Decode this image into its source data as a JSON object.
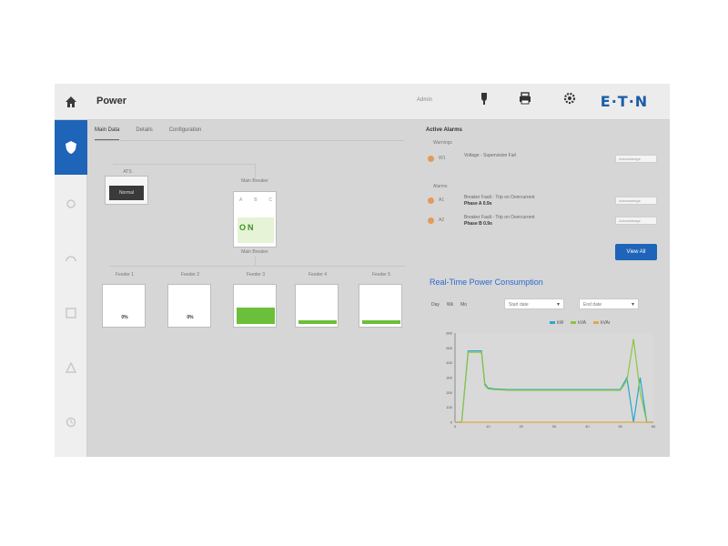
{
  "header": {
    "title": "Power",
    "user_text": "Admin",
    "icons": [
      {
        "name": "plug-icon",
        "label": ""
      },
      {
        "name": "print-icon",
        "label": ""
      },
      {
        "name": "gear-icon",
        "label": ""
      }
    ],
    "logo_text": "E·T·N"
  },
  "rail": {
    "active_icon": "shield-icon",
    "items": [
      "settings-icon",
      "meter-icon",
      "grid-icon",
      "alarm-icon",
      "history-icon"
    ]
  },
  "tabs": [
    "Main Data",
    "Details",
    "Configuration"
  ],
  "oneline": {
    "source_label": "ATS",
    "source_value": "Normal",
    "breaker_title": "Main Breaker",
    "breaker_labels": [
      "A",
      "B",
      "C"
    ],
    "breaker_value": "ON",
    "breaker_sub": "Main Breaker",
    "meters": [
      {
        "label": "Feeder 1",
        "value": "0%",
        "level": 0
      },
      {
        "label": "Feeder 2",
        "value": "0%",
        "level": 0
      },
      {
        "label": "Feeder 3",
        "value": "",
        "level": 0.42
      },
      {
        "label": "Feeder 4",
        "value": "",
        "level": 0.1
      },
      {
        "label": "Feeder 5",
        "value": "",
        "level": 0.1
      }
    ]
  },
  "alarms": {
    "title": "Active Alarms",
    "groups": [
      "Warnings",
      "Alarms"
    ],
    "rows": [
      {
        "code": "W1",
        "desc": "Voltage - Supervision Fail",
        "desc2": "",
        "ack": "Acknowledge"
      },
      {
        "code": "A1",
        "desc": "Breaker Fault - Trip on Overcurrent",
        "desc2": "Phase A 0.9s",
        "ack": "Acknowledge"
      },
      {
        "code": "A2",
        "desc": "Breaker Fault - Trip on Overcurrent",
        "desc2": "Phase B 0.9s",
        "ack": "Acknowledge"
      }
    ],
    "view_all": "View All"
  },
  "chart_panel": {
    "title": "Real-Time Power Consumption",
    "controls": [
      "Day",
      "Wk",
      "Mo"
    ],
    "dropdown1": "Start date",
    "dropdown2": "End date"
  },
  "chart_data": {
    "type": "line",
    "title": "Real-Time Power Consumption",
    "xlabel": "",
    "ylabel": "",
    "x": [
      0,
      2,
      4,
      6,
      8,
      9,
      10,
      12,
      14,
      16,
      18,
      20,
      22,
      24,
      26,
      28,
      30,
      32,
      34,
      36,
      38,
      40,
      42,
      44,
      46,
      48,
      50,
      52,
      54,
      56,
      58,
      60
    ],
    "x_ticks": [
      "0",
      "10",
      "20",
      "30",
      "40",
      "50",
      "60"
    ],
    "y_ticks": [
      "0",
      "100",
      "200",
      "300",
      "400",
      "500",
      "600"
    ],
    "ylim": [
      0,
      600
    ],
    "series": [
      {
        "name": "kW",
        "color": "#2aa7c9",
        "values": [
          0,
          0,
          480,
          480,
          480,
          260,
          230,
          225,
          222,
          220,
          220,
          220,
          220,
          220,
          220,
          220,
          220,
          220,
          220,
          220,
          220,
          220,
          220,
          220,
          220,
          220,
          220,
          300,
          0,
          300,
          0,
          0
        ]
      },
      {
        "name": "kVA",
        "color": "#8cc63f",
        "values": [
          0,
          0,
          470,
          470,
          470,
          250,
          225,
          220,
          218,
          215,
          215,
          215,
          215,
          215,
          215,
          215,
          215,
          215,
          215,
          215,
          215,
          215,
          215,
          215,
          215,
          215,
          215,
          280,
          560,
          200,
          0,
          0
        ]
      },
      {
        "name": "kVAr",
        "color": "#e0a84a",
        "values": [
          0,
          0,
          0,
          0,
          0,
          0,
          0,
          0,
          0,
          0,
          0,
          0,
          0,
          0,
          0,
          0,
          0,
          0,
          0,
          0,
          0,
          0,
          0,
          0,
          0,
          0,
          0,
          0,
          0,
          0,
          0,
          0
        ]
      }
    ],
    "legend": "top-right",
    "grid": false
  }
}
